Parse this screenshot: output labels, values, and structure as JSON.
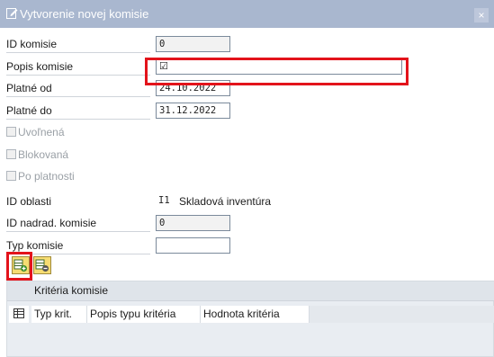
{
  "window": {
    "title": "Vytvorenie novej komisie",
    "close_glyph": "×"
  },
  "form": {
    "id_komisie": {
      "label": "ID komisie",
      "value": "0"
    },
    "popis_komisie": {
      "label": "Popis komisie",
      "value": "☑"
    },
    "platne_od": {
      "label": "Platné od",
      "value": "24.10.2022"
    },
    "platne_do": {
      "label": "Platné do",
      "value": "31.12.2022"
    },
    "uvolnena": {
      "label": "Uvoľnená",
      "checked": false
    },
    "blokovana": {
      "label": "Blokovaná",
      "checked": false
    },
    "po_platnosti": {
      "label": "Po platnosti",
      "checked": false
    },
    "id_oblasti": {
      "label": "ID oblasti",
      "value": "I1",
      "description": "Skladová inventúra"
    },
    "id_nadrad_komisie": {
      "label": "ID nadrad. komisie",
      "value": "0"
    },
    "typ_komisie": {
      "label": "Typ komisie",
      "value": ""
    }
  },
  "toolbar": {
    "add_row_icon": "add-row-icon",
    "delete_row_icon": "delete-row-icon"
  },
  "criteria": {
    "title": "Kritéria komisie",
    "columns": [
      "Typ krit.",
      "Popis typu kritéria",
      "Hodnota kritéria"
    ]
  },
  "colors": {
    "titlebar": "#a9b7cf",
    "highlight": "#e3131b",
    "button": "#f6dc72"
  }
}
